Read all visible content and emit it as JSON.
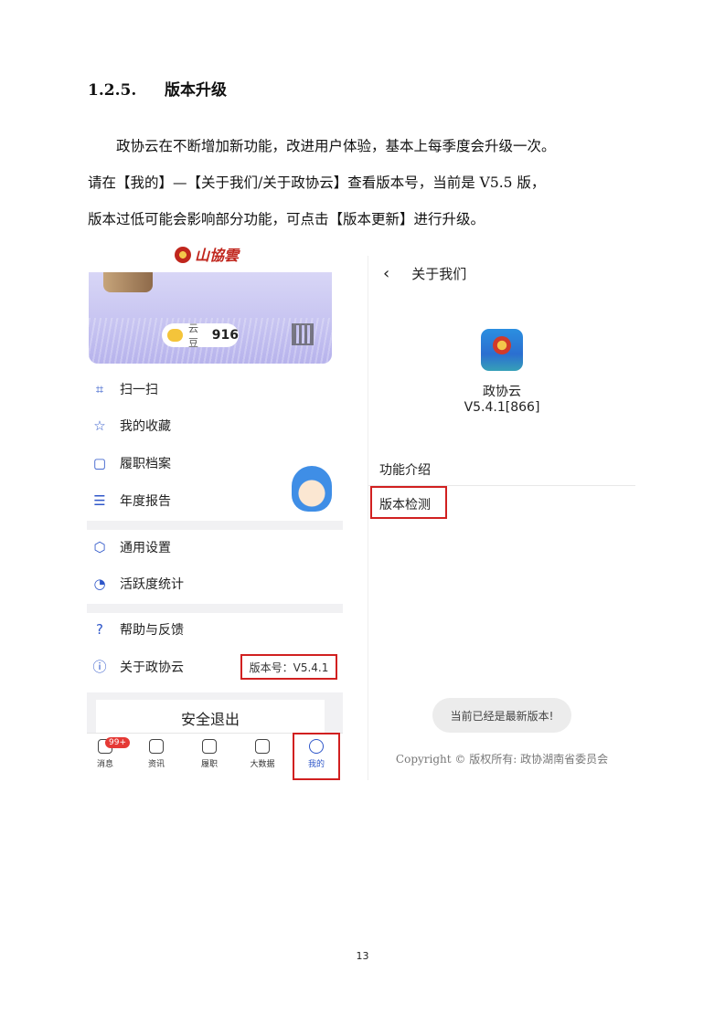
{
  "section": {
    "number": "1.2.5.",
    "title": "版本升级"
  },
  "paragraph": {
    "line1": "政协云在不断增加新功能，改进用户体验，基本上每季度会升级一次。",
    "line2": "请在【我的】—【关于我们/关于政协云】查看版本号，当前是 V5.5 版，",
    "line3": "版本过低可能会影响部分功能，可点击【版本更新】进行升级。"
  },
  "left_screen": {
    "logo_text": "山協雲",
    "coin_label": "云豆",
    "coin_value": "916",
    "menu": [
      {
        "label": "扫一扫",
        "icon": "scan-icon"
      },
      {
        "label": "我的收藏",
        "icon": "star-icon"
      },
      {
        "label": "履职档案",
        "icon": "folder-icon"
      },
      {
        "label": "年度报告",
        "icon": "report-icon"
      },
      {
        "label": "通用设置",
        "icon": "settings-icon"
      },
      {
        "label": "活跃度统计",
        "icon": "pie-chart-icon"
      },
      {
        "label": "帮助与反馈",
        "icon": "help-icon"
      },
      {
        "label": "关于政协云",
        "icon": "info-icon"
      }
    ],
    "version_text": "版本号：V5.4.1",
    "logout_label": "安全退出",
    "tabs": [
      {
        "label": "消息",
        "badge": "99+"
      },
      {
        "label": "资讯"
      },
      {
        "label": "履职"
      },
      {
        "label": "大数据"
      },
      {
        "label": "我的"
      }
    ]
  },
  "right_screen": {
    "nav_back": "‹",
    "nav_title": "关于我们",
    "app_name": "政协云",
    "app_version": "V5.4.1[866]",
    "rows": [
      "功能介绍",
      "版本检测"
    ],
    "toast": "当前已经是最新版本!",
    "copyright": "Copyright © 版权所有: 政协湖南省委员会"
  },
  "page_number": "13",
  "colors": {
    "highlight_red": "#d12020",
    "accent_blue": "#2f57c9"
  }
}
